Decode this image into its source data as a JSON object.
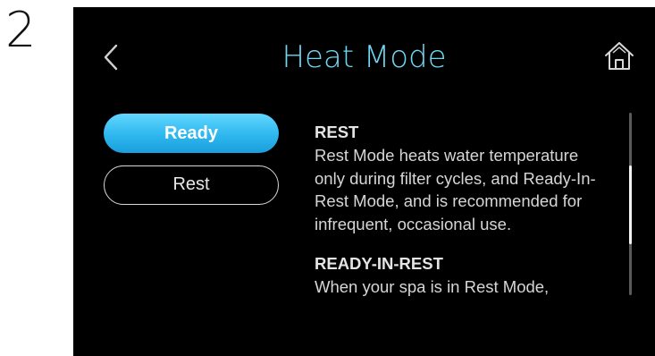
{
  "step_number": "2",
  "header": {
    "title": "Heat Mode",
    "back_icon": "chevron-left-icon",
    "home_icon": "home-icon"
  },
  "modes": {
    "selected": "Ready",
    "options": [
      {
        "label": "Ready",
        "selected": true
      },
      {
        "label": "Rest",
        "selected": false
      }
    ]
  },
  "info": {
    "sections": [
      {
        "heading": "REST",
        "body": "Rest Mode heats water temperature only during filter cycles, and Ready-In-Rest Mode, and is recommended for infrequent, occasional use."
      },
      {
        "heading": "READY-IN-REST",
        "body": "When your spa is in Rest Mode,"
      }
    ]
  },
  "scroll": {
    "position_fraction": 0.29,
    "visible_fraction": 0.43
  },
  "colors": {
    "title": "#6fd6f3",
    "selected_button": "#2eb7ef",
    "screen_background": "#000000"
  }
}
